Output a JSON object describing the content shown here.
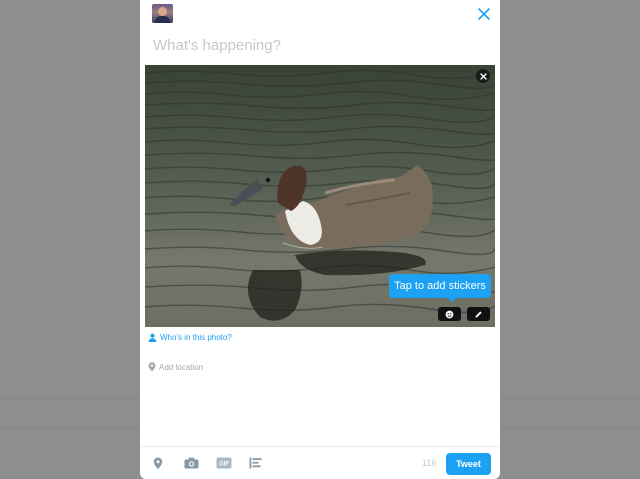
{
  "compose": {
    "placeholder": "What's happening?"
  },
  "photo": {
    "tooltip": "Tap to add stickers",
    "subject_icon": "duck-photo",
    "remove_icon": "close-icon",
    "sticker_icon": "smiley-icon",
    "edit_icon": "pencil-icon"
  },
  "tag_people": {
    "label": "Who's in this photo?",
    "icon": "person-icon"
  },
  "location": {
    "label": "Add location",
    "icon": "location-pin-icon"
  },
  "toolbar": {
    "counter": "116",
    "tweet_label": "Tweet",
    "gif_label": "GIF",
    "icons": [
      "location-pin-icon",
      "camera-icon",
      "gif-icon",
      "poll-icon"
    ]
  },
  "colors": {
    "accent": "#1da1f2",
    "overlay": "#8e8e8e",
    "muted": "#c4c9cd"
  }
}
